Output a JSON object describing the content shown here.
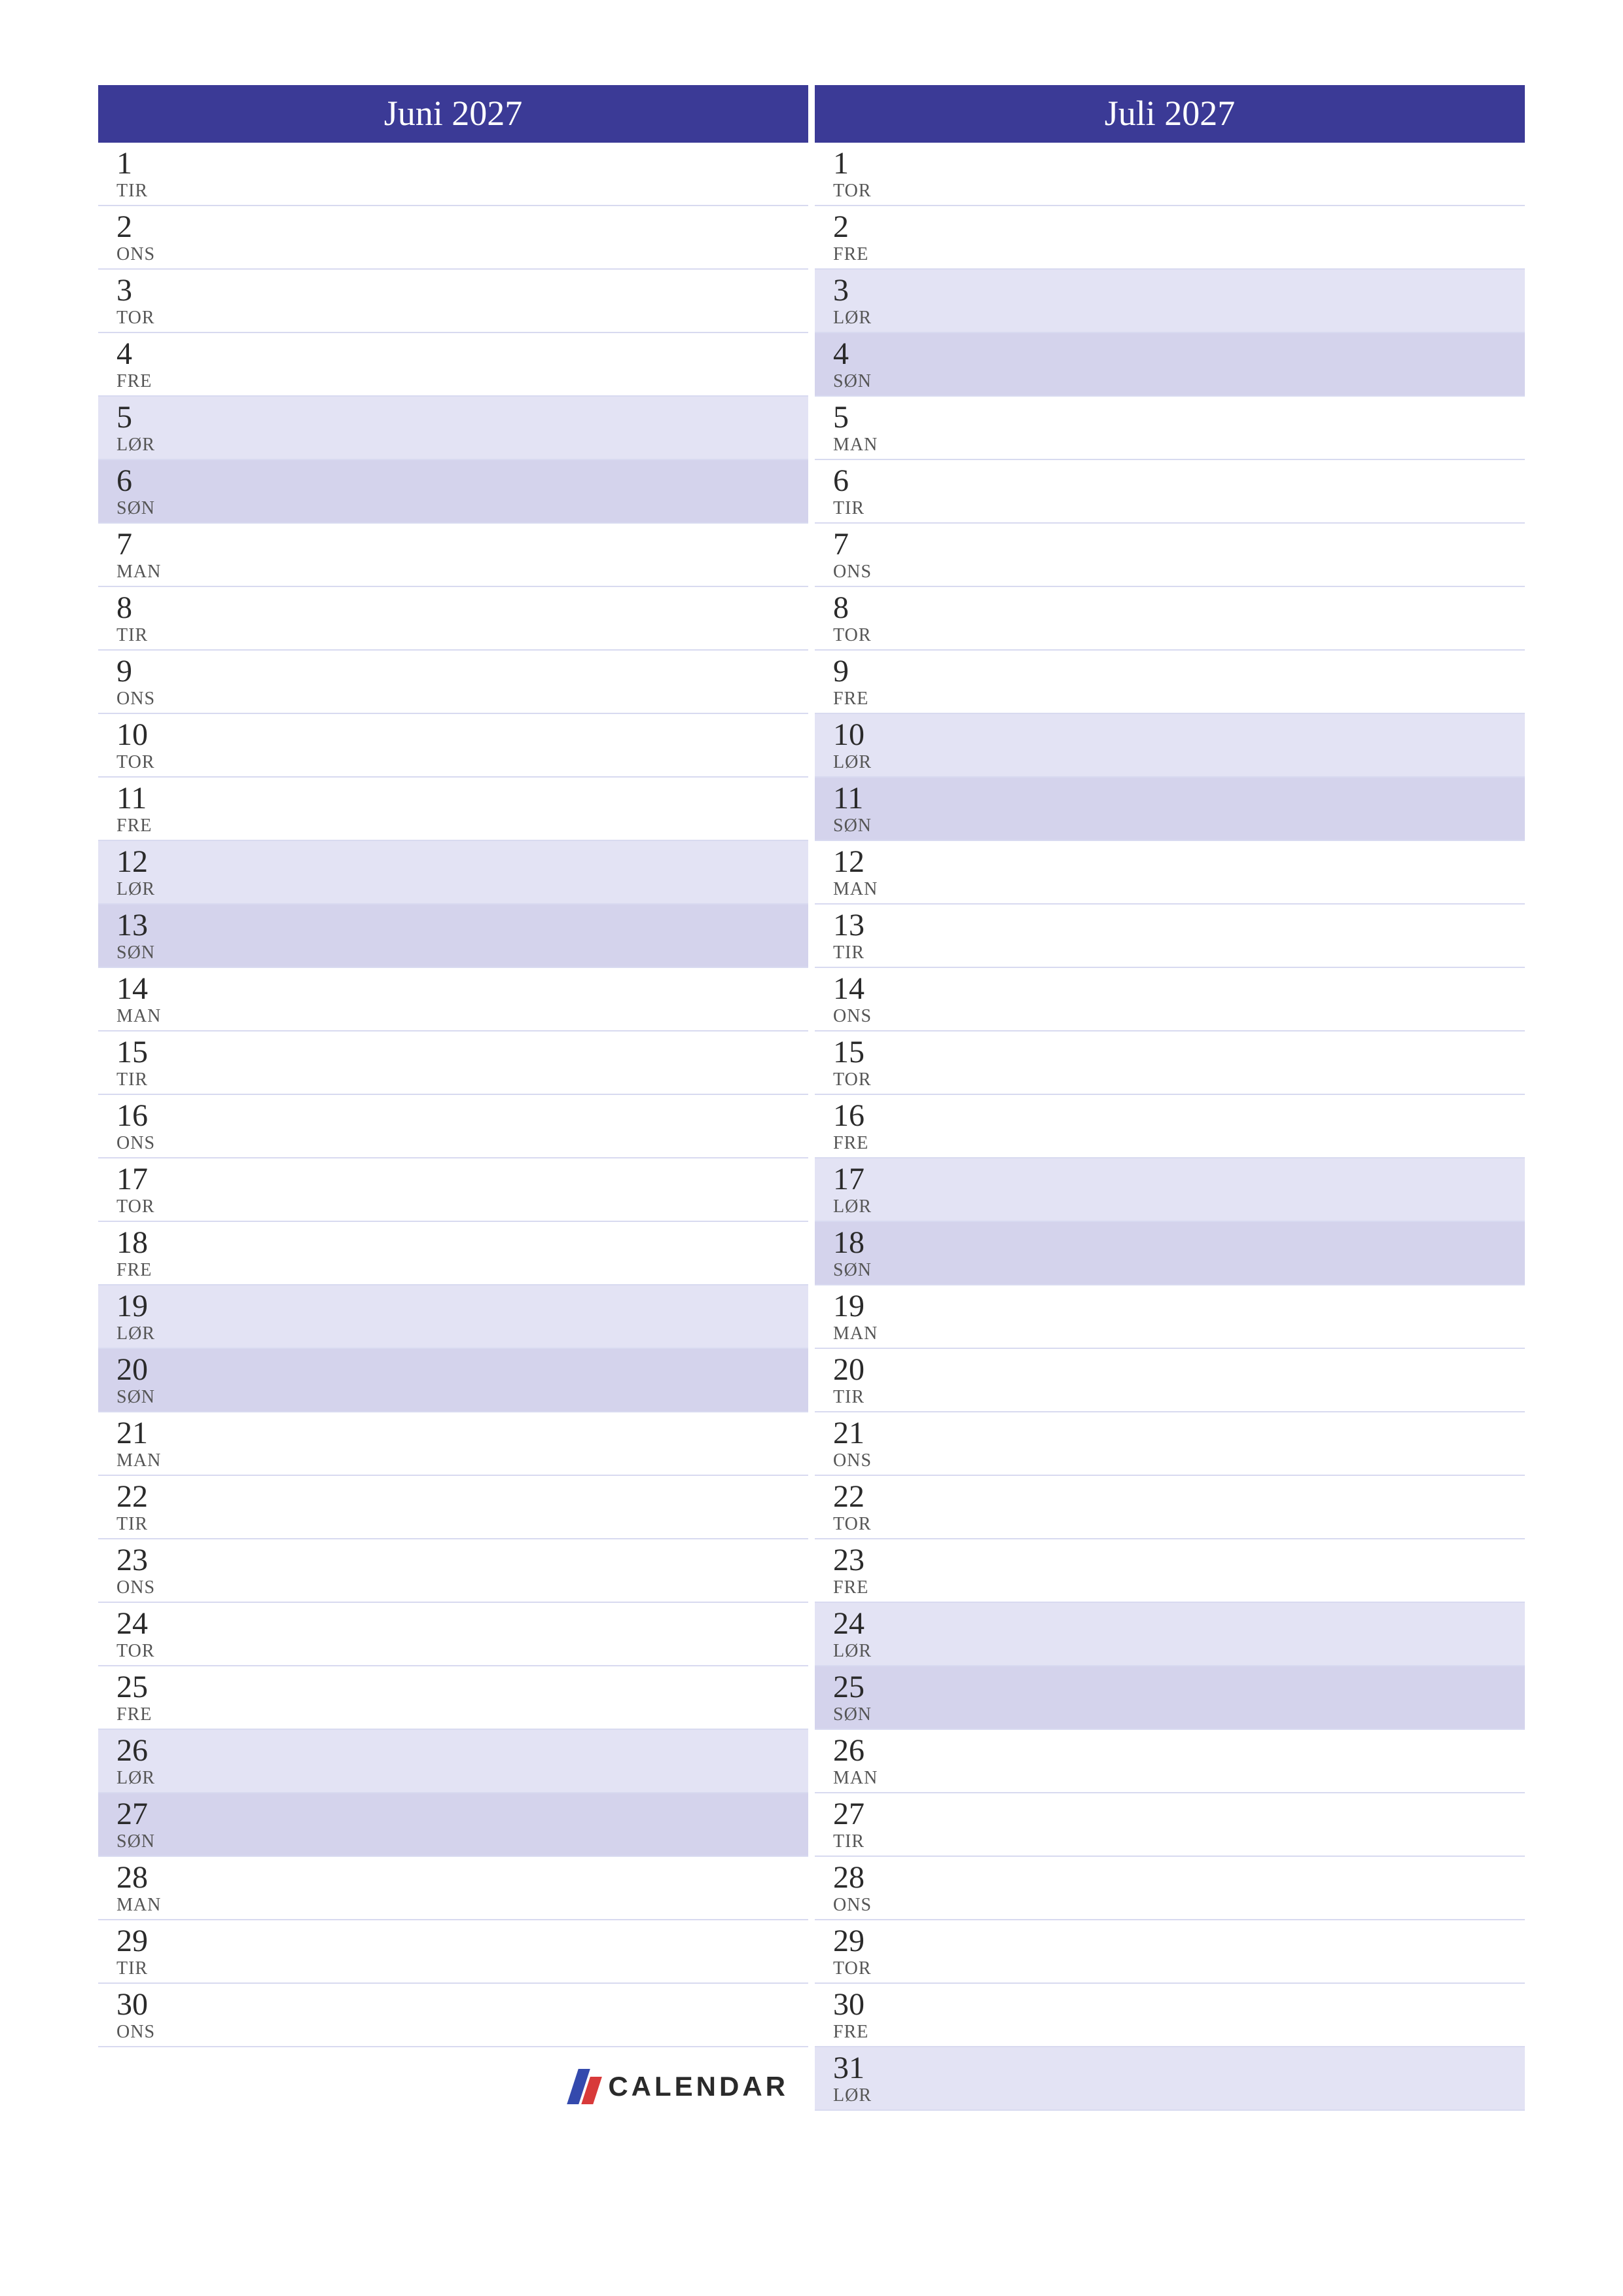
{
  "brand": "CALENDAR",
  "months": [
    {
      "title": "Juni 2027",
      "days": [
        {
          "n": "1",
          "d": "TIR",
          "t": "weekday"
        },
        {
          "n": "2",
          "d": "ONS",
          "t": "weekday"
        },
        {
          "n": "3",
          "d": "TOR",
          "t": "weekday"
        },
        {
          "n": "4",
          "d": "FRE",
          "t": "weekday"
        },
        {
          "n": "5",
          "d": "LØR",
          "t": "sat"
        },
        {
          "n": "6",
          "d": "SØN",
          "t": "sun"
        },
        {
          "n": "7",
          "d": "MAN",
          "t": "weekday"
        },
        {
          "n": "8",
          "d": "TIR",
          "t": "weekday"
        },
        {
          "n": "9",
          "d": "ONS",
          "t": "weekday"
        },
        {
          "n": "10",
          "d": "TOR",
          "t": "weekday"
        },
        {
          "n": "11",
          "d": "FRE",
          "t": "weekday"
        },
        {
          "n": "12",
          "d": "LØR",
          "t": "sat"
        },
        {
          "n": "13",
          "d": "SØN",
          "t": "sun"
        },
        {
          "n": "14",
          "d": "MAN",
          "t": "weekday"
        },
        {
          "n": "15",
          "d": "TIR",
          "t": "weekday"
        },
        {
          "n": "16",
          "d": "ONS",
          "t": "weekday"
        },
        {
          "n": "17",
          "d": "TOR",
          "t": "weekday"
        },
        {
          "n": "18",
          "d": "FRE",
          "t": "weekday"
        },
        {
          "n": "19",
          "d": "LØR",
          "t": "sat"
        },
        {
          "n": "20",
          "d": "SØN",
          "t": "sun"
        },
        {
          "n": "21",
          "d": "MAN",
          "t": "weekday"
        },
        {
          "n": "22",
          "d": "TIR",
          "t": "weekday"
        },
        {
          "n": "23",
          "d": "ONS",
          "t": "weekday"
        },
        {
          "n": "24",
          "d": "TOR",
          "t": "weekday"
        },
        {
          "n": "25",
          "d": "FRE",
          "t": "weekday"
        },
        {
          "n": "26",
          "d": "LØR",
          "t": "sat"
        },
        {
          "n": "27",
          "d": "SØN",
          "t": "sun"
        },
        {
          "n": "28",
          "d": "MAN",
          "t": "weekday"
        },
        {
          "n": "29",
          "d": "TIR",
          "t": "weekday"
        },
        {
          "n": "30",
          "d": "ONS",
          "t": "weekday"
        }
      ]
    },
    {
      "title": "Juli 2027",
      "days": [
        {
          "n": "1",
          "d": "TOR",
          "t": "weekday"
        },
        {
          "n": "2",
          "d": "FRE",
          "t": "weekday"
        },
        {
          "n": "3",
          "d": "LØR",
          "t": "sat"
        },
        {
          "n": "4",
          "d": "SØN",
          "t": "sun"
        },
        {
          "n": "5",
          "d": "MAN",
          "t": "weekday"
        },
        {
          "n": "6",
          "d": "TIR",
          "t": "weekday"
        },
        {
          "n": "7",
          "d": "ONS",
          "t": "weekday"
        },
        {
          "n": "8",
          "d": "TOR",
          "t": "weekday"
        },
        {
          "n": "9",
          "d": "FRE",
          "t": "weekday"
        },
        {
          "n": "10",
          "d": "LØR",
          "t": "sat"
        },
        {
          "n": "11",
          "d": "SØN",
          "t": "sun"
        },
        {
          "n": "12",
          "d": "MAN",
          "t": "weekday"
        },
        {
          "n": "13",
          "d": "TIR",
          "t": "weekday"
        },
        {
          "n": "14",
          "d": "ONS",
          "t": "weekday"
        },
        {
          "n": "15",
          "d": "TOR",
          "t": "weekday"
        },
        {
          "n": "16",
          "d": "FRE",
          "t": "weekday"
        },
        {
          "n": "17",
          "d": "LØR",
          "t": "sat"
        },
        {
          "n": "18",
          "d": "SØN",
          "t": "sun"
        },
        {
          "n": "19",
          "d": "MAN",
          "t": "weekday"
        },
        {
          "n": "20",
          "d": "TIR",
          "t": "weekday"
        },
        {
          "n": "21",
          "d": "ONS",
          "t": "weekday"
        },
        {
          "n": "22",
          "d": "TOR",
          "t": "weekday"
        },
        {
          "n": "23",
          "d": "FRE",
          "t": "weekday"
        },
        {
          "n": "24",
          "d": "LØR",
          "t": "sat"
        },
        {
          "n": "25",
          "d": "SØN",
          "t": "sun"
        },
        {
          "n": "26",
          "d": "MAN",
          "t": "weekday"
        },
        {
          "n": "27",
          "d": "TIR",
          "t": "weekday"
        },
        {
          "n": "28",
          "d": "ONS",
          "t": "weekday"
        },
        {
          "n": "29",
          "d": "TOR",
          "t": "weekday"
        },
        {
          "n": "30",
          "d": "FRE",
          "t": "weekday"
        },
        {
          "n": "31",
          "d": "LØR",
          "t": "sat"
        }
      ]
    }
  ]
}
